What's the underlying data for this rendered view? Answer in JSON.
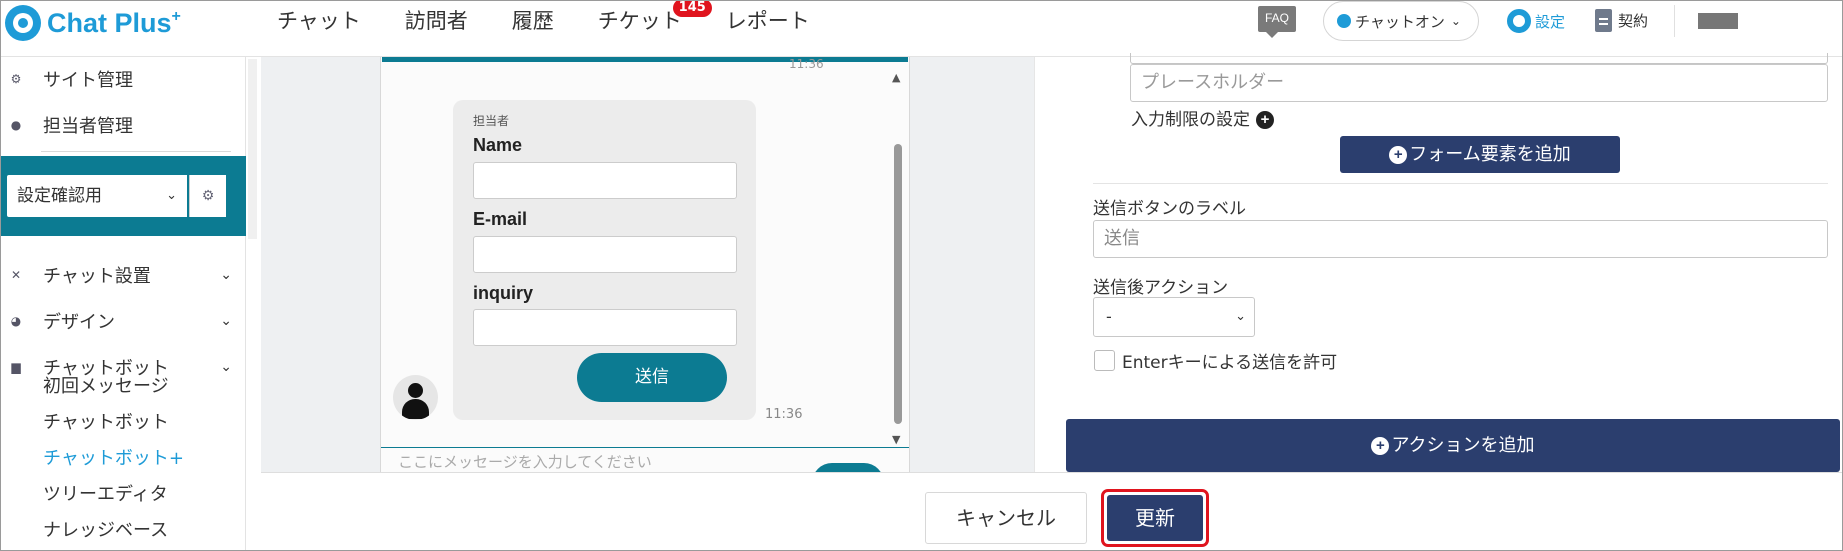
{
  "header": {
    "logo_text": "Chat Plus",
    "logo_sup": "+",
    "nav": [
      {
        "label": "チャット"
      },
      {
        "label": "訪問者"
      },
      {
        "label": "履歴"
      },
      {
        "label": "チケット",
        "badge": "145"
      },
      {
        "label": "レポート"
      }
    ],
    "faq": "FAQ",
    "chat_status": "チャットオン",
    "settings": "設定",
    "contract": "契約"
  },
  "sidebar": {
    "site_admin": "サイト管理",
    "staff_admin": "担当者管理",
    "site_select": "設定確認用",
    "chat_settings": "チャット設置",
    "design": "デザイン",
    "chatbot": "チャットボット",
    "sub_items": [
      {
        "label": "初回メッセージ",
        "active": false
      },
      {
        "label": "チャットボット",
        "active": false
      },
      {
        "label": "チャットボット+",
        "active": true
      },
      {
        "label": "ツリーエディタ",
        "active": false
      },
      {
        "label": "ナレッジベース",
        "active": false
      }
    ]
  },
  "preview": {
    "top_time": "11:36",
    "agent_label": "担当者",
    "fields": [
      {
        "label": "Name"
      },
      {
        "label": "E-mail"
      },
      {
        "label": "inquiry"
      }
    ],
    "send_button": "送信",
    "bubble_time": "11:36",
    "message_placeholder": "ここにメッセージを入力してください"
  },
  "form": {
    "placeholder_field_value": "プレースホルダー",
    "input_limit_label": "入力制限の設定",
    "add_form_element": "フォーム要素を追加",
    "send_label_title": "送信ボタンのラベル",
    "send_label_value": "送信",
    "post_action_title": "送信後アクション",
    "post_action_value": "-",
    "enter_key_label": "Enterキーによる送信を許可",
    "add_action": "アクションを追加"
  },
  "footer": {
    "cancel": "キャンセル",
    "update": "更新"
  },
  "colors": {
    "brand_blue": "#1e9bd7",
    "teal": "#0c7b92",
    "navy": "#2b3e6e",
    "highlight_red": "#e0141e"
  }
}
